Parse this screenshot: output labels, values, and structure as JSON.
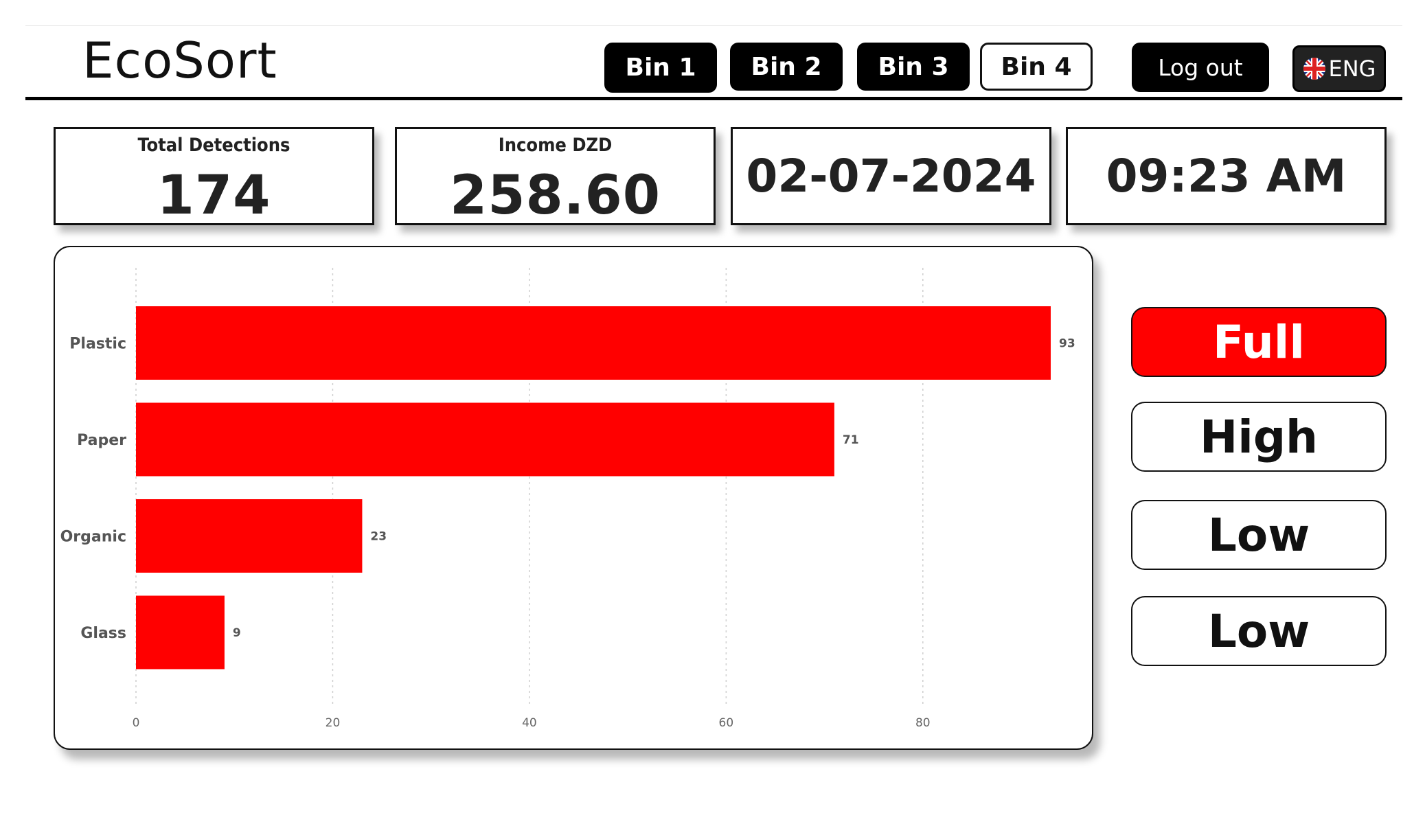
{
  "app": {
    "title": "EcoSort"
  },
  "nav": {
    "bins": [
      "Bin 1",
      "Bin 2",
      "Bin 3",
      "Bin 4"
    ],
    "active_bin": "Bin 4",
    "logout_label": "Log out",
    "language_label": "ENG",
    "language_icon": "uk-flag-icon"
  },
  "kpis": {
    "total_detections": {
      "label": "Total Detections",
      "value": "174"
    },
    "income": {
      "label": "Income DZD",
      "value": "258.60"
    },
    "date": "02-07-2024",
    "time": "09:23 AM"
  },
  "bin_levels": [
    {
      "label": "Full",
      "status": "full"
    },
    {
      "label": "High",
      "status": "normal"
    },
    {
      "label": "Low",
      "status": "normal"
    },
    {
      "label": "Low",
      "status": "normal"
    }
  ],
  "colors": {
    "bar": "#ff0000",
    "full_status": "#ff0000",
    "nav_dark": "#000000"
  },
  "chart_data": {
    "type": "bar",
    "orientation": "horizontal",
    "categories": [
      "Plastic",
      "Paper",
      "Organic",
      "Glass"
    ],
    "values": [
      93,
      71,
      23,
      9
    ],
    "xticks": [
      0,
      20,
      40,
      60,
      80
    ],
    "xlim": [
      0,
      93
    ],
    "grid": "vertical dotted",
    "data_labels": true
  }
}
